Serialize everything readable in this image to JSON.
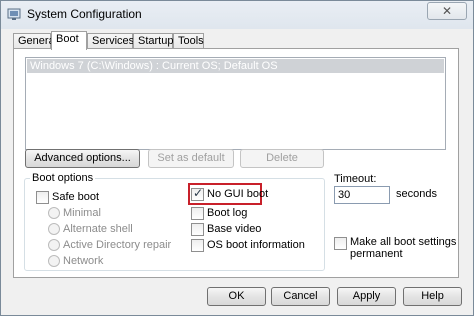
{
  "window": {
    "title": "System Configuration",
    "close_glyph": "✕",
    "app_icon": "system-config-icon"
  },
  "tabs": [
    {
      "label": "General",
      "active": false
    },
    {
      "label": "Boot",
      "active": true
    },
    {
      "label": "Services",
      "active": false
    },
    {
      "label": "Startup",
      "active": false
    },
    {
      "label": "Tools",
      "active": false
    }
  ],
  "os_list": {
    "items": [
      "Windows 7 (C:\\Windows) : Current OS; Default OS"
    ]
  },
  "buttons": {
    "advanced": "Advanced options...",
    "set_default": "Set as default",
    "delete": "Delete",
    "ok": "OK",
    "cancel": "Cancel",
    "apply": "Apply",
    "help": "Help"
  },
  "boot_options": {
    "legend": "Boot options",
    "safe_boot": {
      "label": "Safe boot",
      "checked": false
    },
    "radios": [
      "Minimal",
      "Alternate shell",
      "Active Directory repair",
      "Network"
    ],
    "no_gui": {
      "label": "No GUI boot",
      "checked": true
    },
    "boot_log": {
      "label": "Boot log",
      "checked": false
    },
    "base_video": {
      "label": "Base video",
      "checked": false
    },
    "os_info": {
      "label": "OS boot information",
      "checked": false
    }
  },
  "timeout": {
    "label": "Timeout:",
    "value": "30",
    "unit": "seconds"
  },
  "permanent": {
    "label_line1": "Make all boot settings",
    "label_line2": "permanent",
    "checked": false
  },
  "colors": {
    "highlight": "#c8202a",
    "selection": "#cfd2d6"
  }
}
